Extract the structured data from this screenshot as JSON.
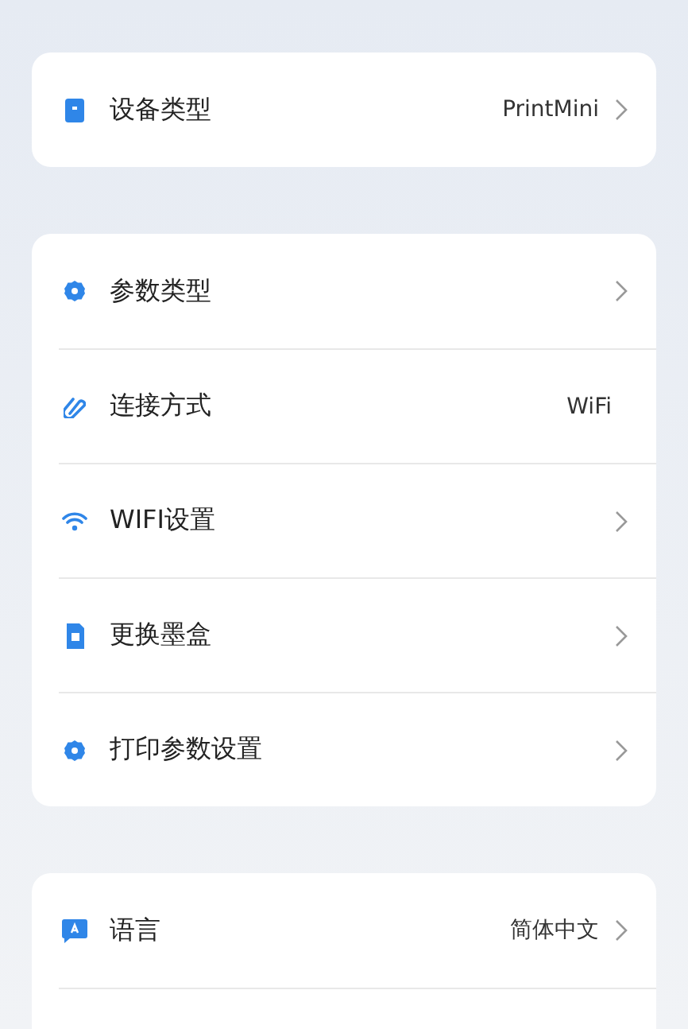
{
  "groups": [
    {
      "rows": [
        {
          "kind": "device",
          "label": "设备类型",
          "value": "PrintMini",
          "chevron": true
        }
      ]
    },
    {
      "rows": [
        {
          "kind": "gear",
          "label": "参数类型",
          "chevron": true
        },
        {
          "kind": "link",
          "label": "连接方式",
          "value": "WiFi",
          "chevron": false
        },
        {
          "kind": "wifi",
          "label": "WIFI设置",
          "chevron": true
        },
        {
          "kind": "cartridge",
          "label": "更换墨盒",
          "chevron": true
        },
        {
          "kind": "gear",
          "label": "打印参数设置",
          "chevron": true
        }
      ]
    },
    {
      "rows": [
        {
          "kind": "language",
          "label": "语言",
          "value": "简体中文",
          "chevron": true
        }
      ]
    }
  ]
}
